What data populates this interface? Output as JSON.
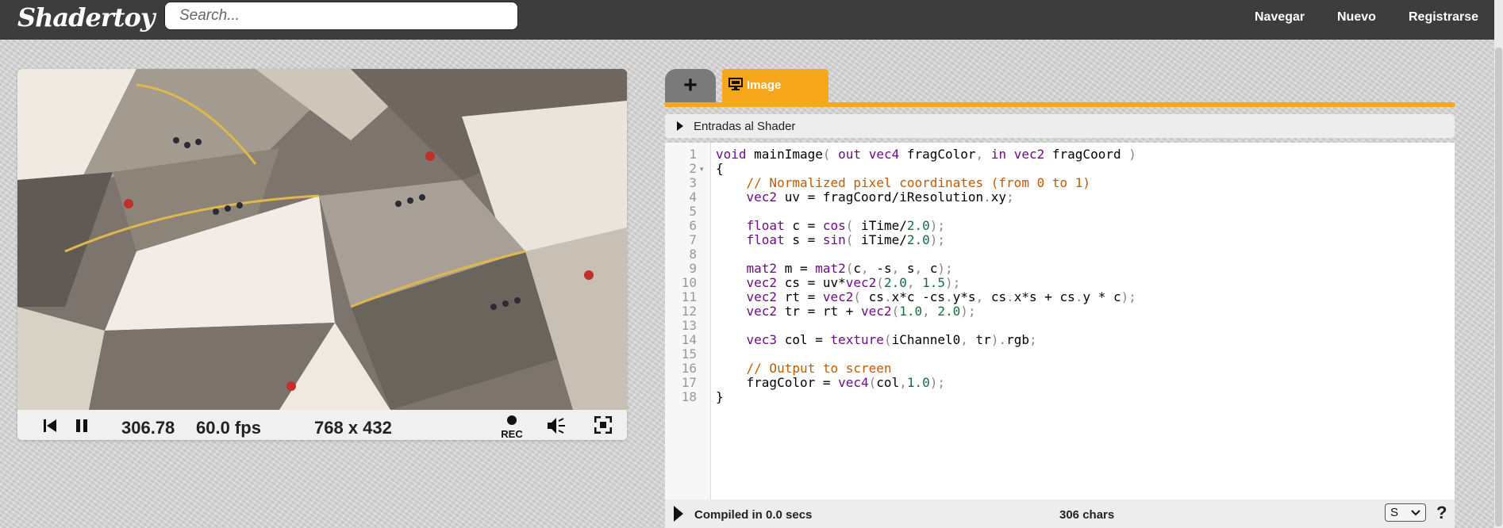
{
  "header": {
    "logo": "Shadertoy",
    "search_placeholder": "Search...",
    "nav": [
      "Navegar",
      "Nuevo",
      "Registrarse"
    ]
  },
  "player": {
    "time": "306.78",
    "fps": "60.0 fps",
    "resolution": "768 x 432",
    "rec_label": "REC",
    "icons": [
      "rewind-icon",
      "pause-icon",
      "record-icon",
      "volume-icon",
      "fullscreen-icon"
    ]
  },
  "editor": {
    "add_tab_label": "+",
    "tab_label": "Image",
    "inputs_label": "Entradas al Shader",
    "compile_status": "Compiled in 0.0 secs",
    "char_count": "306 chars",
    "font_size_option": "S",
    "help_label": "?",
    "line_numbers": [
      "1",
      "2",
      "3",
      "4",
      "5",
      "6",
      "7",
      "8",
      "9",
      "10",
      "11",
      "12",
      "13",
      "14",
      "15",
      "16",
      "17",
      "18"
    ],
    "code_lines": [
      "void mainImage( out vec4 fragColor, in vec2 fragCoord )",
      "{",
      "    // Normalized pixel coordinates (from 0 to 1)",
      "    vec2 uv = fragCoord/iResolution.xy;",
      "",
      "    float c = cos( iTime/2.0);",
      "    float s = sin( iTime/2.0);",
      "",
      "    mat2 m = mat2(c, -s, s, c);",
      "    vec2 cs = uv*vec2(2.0, 1.5);",
      "    vec2 rt = vec2( cs.x*c -cs.y*s, cs.x*s + cs.y * c);",
      "    vec2 tr = rt + vec2(1.0, 2.0);",
      "",
      "    vec3 col = texture(iChannel0, tr).rgb;",
      "",
      "    // Output to screen",
      "    fragColor = vec4(col,1.0);",
      "}"
    ]
  },
  "colors": {
    "accent": "#f7a71b",
    "header_bg": "#3d3d3d",
    "keyword": "#6f0a8a",
    "comment": "#c25a00",
    "number": "#146f3b"
  }
}
